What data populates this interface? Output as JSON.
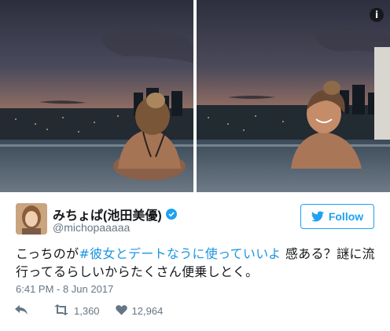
{
  "media": {
    "info_icon": "i",
    "photos": [
      {
        "name": "photo-left",
        "icon": "landscape-photo"
      },
      {
        "name": "photo-right",
        "icon": "landscape-photo"
      }
    ]
  },
  "author": {
    "display_name": "みちょぱ(池田美優)",
    "handle": "@michopaaaaa",
    "verified": true
  },
  "follow_button": {
    "label": "Follow",
    "icon": "twitter-bird-icon"
  },
  "tweet": {
    "text_before": "こっちのが",
    "hashtag": "#彼女とデートなうに使っていいよ",
    "text_after": " 感ある？謎に流行ってるらしいからたくさん便乗しとく。",
    "timestamp": "6:41 PM - 8 Jun 2017"
  },
  "actions": {
    "reply_icon": "reply-icon",
    "retweet_count": "1,360",
    "like_count": "12,964"
  },
  "colors": {
    "accent": "#1da1f2",
    "hashtag": "#1b95e0",
    "muted": "#657786"
  }
}
